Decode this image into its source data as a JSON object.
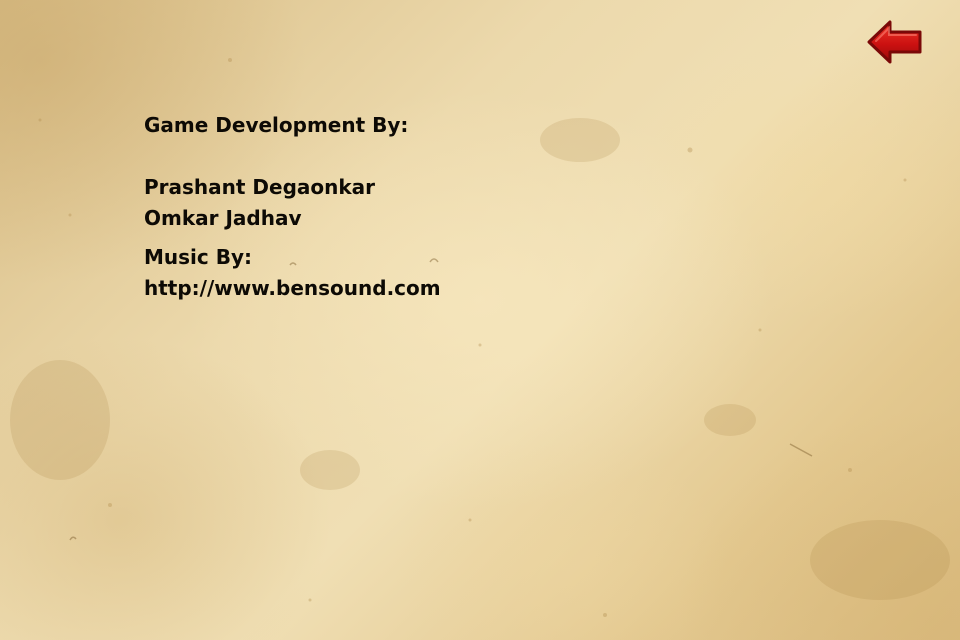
{
  "credits": {
    "development_heading": "Game Development By:",
    "developers": [
      "Prashant Degaonkar",
      "Omkar Jadhav"
    ],
    "music_heading": "Music By:",
    "music_source": "http://www.bensound.com"
  },
  "controls": {
    "back_icon": "red-left-arrow-icon"
  },
  "colors": {
    "background": "#ecd9ac",
    "text": "#0d0a05",
    "arrow_fill": "#cc1111",
    "arrow_outline": "#7a0808"
  }
}
